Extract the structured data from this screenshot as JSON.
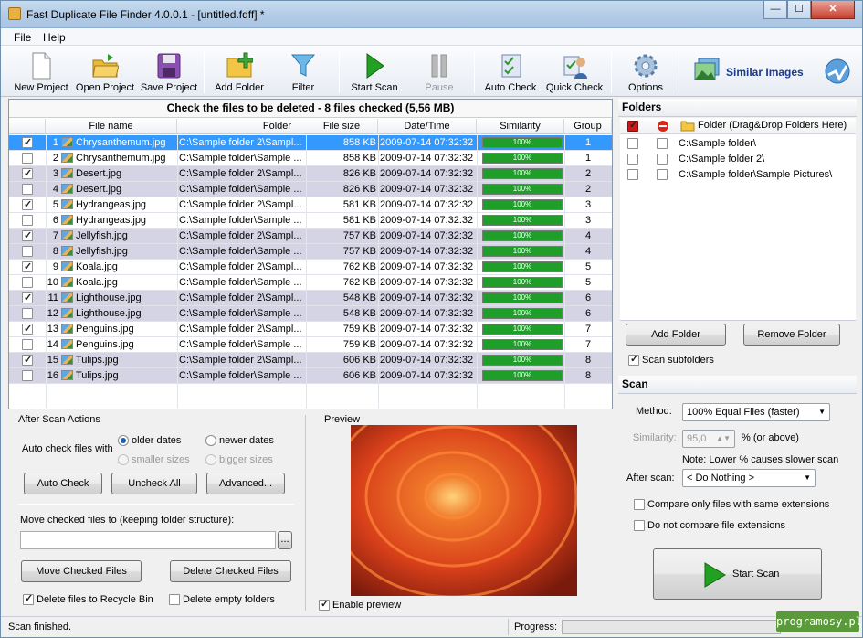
{
  "window": {
    "title": "Fast Duplicate File Finder 4.0.0.1 - [untitled.fdff] *",
    "min": "—",
    "max": "☐",
    "close": "✕"
  },
  "menu": {
    "file": "File",
    "help": "Help"
  },
  "toolbar": {
    "new_project": "New Project",
    "open_project": "Open Project",
    "save_project": "Save Project",
    "add_folder": "Add Folder",
    "filter": "Filter",
    "start_scan": "Start Scan",
    "pause": "Pause",
    "auto_check": "Auto Check",
    "quick_check": "Quick Check",
    "options": "Options",
    "similar_images": "Similar Images"
  },
  "files": {
    "header": "Check the files to be deleted - 8 files checked (5,56 MB)",
    "columns": {
      "name": "File name",
      "folder": "Folder",
      "size": "File size",
      "date": "Date/Time",
      "similarity": "Similarity",
      "group": "Group"
    },
    "rows": [
      {
        "checked": true,
        "num": "1",
        "name": "Chrysanthemum.jpg",
        "folder": "C:\\Sample folder 2\\Sampl...",
        "size": "858 KB",
        "date": "2009-07-14 07:32:32",
        "sim": "100%",
        "group": "1"
      },
      {
        "checked": false,
        "num": "2",
        "name": "Chrysanthemum.jpg",
        "folder": "C:\\Sample folder\\Sample ...",
        "size": "858 KB",
        "date": "2009-07-14 07:32:32",
        "sim": "100%",
        "group": "1"
      },
      {
        "checked": true,
        "num": "3",
        "name": "Desert.jpg",
        "folder": "C:\\Sample folder 2\\Sampl...",
        "size": "826 KB",
        "date": "2009-07-14 07:32:32",
        "sim": "100%",
        "group": "2"
      },
      {
        "checked": false,
        "num": "4",
        "name": "Desert.jpg",
        "folder": "C:\\Sample folder\\Sample ...",
        "size": "826 KB",
        "date": "2009-07-14 07:32:32",
        "sim": "100%",
        "group": "2"
      },
      {
        "checked": true,
        "num": "5",
        "name": "Hydrangeas.jpg",
        "folder": "C:\\Sample folder 2\\Sampl...",
        "size": "581 KB",
        "date": "2009-07-14 07:32:32",
        "sim": "100%",
        "group": "3"
      },
      {
        "checked": false,
        "num": "6",
        "name": "Hydrangeas.jpg",
        "folder": "C:\\Sample folder\\Sample ...",
        "size": "581 KB",
        "date": "2009-07-14 07:32:32",
        "sim": "100%",
        "group": "3"
      },
      {
        "checked": true,
        "num": "7",
        "name": "Jellyfish.jpg",
        "folder": "C:\\Sample folder 2\\Sampl...",
        "size": "757 KB",
        "date": "2009-07-14 07:32:32",
        "sim": "100%",
        "group": "4"
      },
      {
        "checked": false,
        "num": "8",
        "name": "Jellyfish.jpg",
        "folder": "C:\\Sample folder\\Sample ...",
        "size": "757 KB",
        "date": "2009-07-14 07:32:32",
        "sim": "100%",
        "group": "4"
      },
      {
        "checked": true,
        "num": "9",
        "name": "Koala.jpg",
        "folder": "C:\\Sample folder 2\\Sampl...",
        "size": "762 KB",
        "date": "2009-07-14 07:32:32",
        "sim": "100%",
        "group": "5"
      },
      {
        "checked": false,
        "num": "10",
        "name": "Koala.jpg",
        "folder": "C:\\Sample folder\\Sample ...",
        "size": "762 KB",
        "date": "2009-07-14 07:32:32",
        "sim": "100%",
        "group": "5"
      },
      {
        "checked": true,
        "num": "11",
        "name": "Lighthouse.jpg",
        "folder": "C:\\Sample folder 2\\Sampl...",
        "size": "548 KB",
        "date": "2009-07-14 07:32:32",
        "sim": "100%",
        "group": "6"
      },
      {
        "checked": false,
        "num": "12",
        "name": "Lighthouse.jpg",
        "folder": "C:\\Sample folder\\Sample ...",
        "size": "548 KB",
        "date": "2009-07-14 07:32:32",
        "sim": "100%",
        "group": "6"
      },
      {
        "checked": true,
        "num": "13",
        "name": "Penguins.jpg",
        "folder": "C:\\Sample folder 2\\Sampl...",
        "size": "759 KB",
        "date": "2009-07-14 07:32:32",
        "sim": "100%",
        "group": "7"
      },
      {
        "checked": false,
        "num": "14",
        "name": "Penguins.jpg",
        "folder": "C:\\Sample folder\\Sample ...",
        "size": "759 KB",
        "date": "2009-07-14 07:32:32",
        "sim": "100%",
        "group": "7"
      },
      {
        "checked": true,
        "num": "15",
        "name": "Tulips.jpg",
        "folder": "C:\\Sample folder 2\\Sampl...",
        "size": "606 KB",
        "date": "2009-07-14 07:32:32",
        "sim": "100%",
        "group": "8"
      },
      {
        "checked": false,
        "num": "16",
        "name": "Tulips.jpg",
        "folder": "C:\\Sample folder\\Sample ...",
        "size": "606 KB",
        "date": "2009-07-14 07:32:32",
        "sim": "100%",
        "group": "8"
      }
    ]
  },
  "after_scan": {
    "title": "After Scan Actions",
    "auto_check_with": "Auto check files with",
    "older": "older dates",
    "newer": "newer dates",
    "smaller": "smaller sizes",
    "bigger": "bigger sizes",
    "auto_check_btn": "Auto Check",
    "uncheck_all_btn": "Uncheck All",
    "advanced_btn": "Advanced...",
    "move_label": "Move checked files to (keeping folder structure):",
    "move_value": "",
    "browse": "...",
    "move_btn": "Move Checked Files",
    "delete_btn": "Delete Checked Files",
    "recycle": "Delete files to Recycle Bin",
    "recycle_checked": true,
    "empty_folders": "Delete empty folders",
    "empty_checked": false
  },
  "preview": {
    "title": "Preview",
    "enable": "Enable preview",
    "enable_checked": true
  },
  "folders": {
    "title": "Folders",
    "header": "Folder (Drag&Drop Folders Here)",
    "items": [
      "C:\\Sample folder\\",
      "C:\\Sample folder 2\\",
      "C:\\Sample folder\\Sample Pictures\\"
    ],
    "add_btn": "Add Folder",
    "remove_btn": "Remove Folder",
    "scan_sub": "Scan subfolders",
    "scan_sub_checked": true
  },
  "scan": {
    "title": "Scan",
    "method_label": "Method:",
    "method_value": "100% Equal Files (faster)",
    "similarity_label": "Similarity:",
    "similarity_value": "95,0",
    "similarity_unit": "% (or above)",
    "note": "Note: Lower % causes slower scan",
    "after_label": "After scan:",
    "after_value": "< Do Nothing >",
    "same_ext": "Compare only files with same extensions",
    "no_ext": "Do not compare file extensions",
    "start_btn": "Start Scan"
  },
  "status": {
    "text": "Scan finished.",
    "progress_label": "Progress:",
    "progress_value": 0
  },
  "watermark": "programosy.pl"
}
